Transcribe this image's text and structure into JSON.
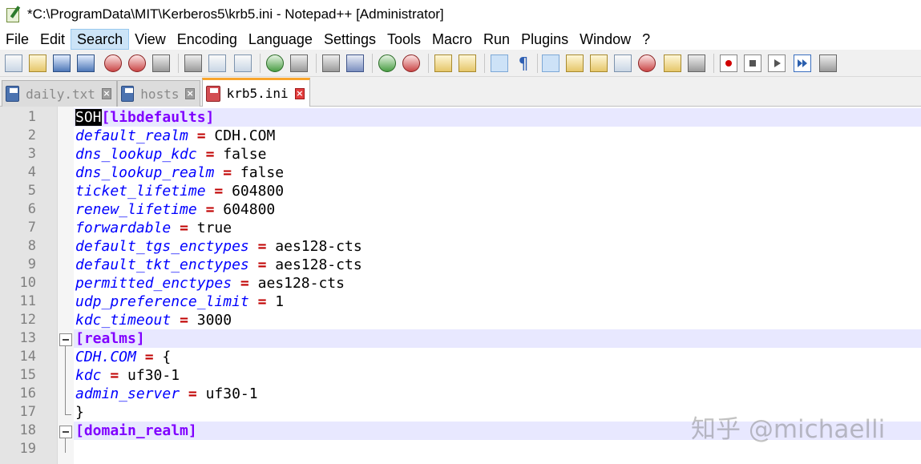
{
  "window": {
    "title": "*C:\\ProgramData\\MIT\\Kerberos5\\krb5.ini - Notepad++ [Administrator]"
  },
  "menu": [
    "File",
    "Edit",
    "Search",
    "View",
    "Encoding",
    "Language",
    "Settings",
    "Tools",
    "Macro",
    "Run",
    "Plugins",
    "Window",
    "?"
  ],
  "menu_active": "Search",
  "tabs": [
    {
      "label": "daily.txt",
      "icon": "save-icon",
      "active": false
    },
    {
      "label": "hosts",
      "icon": "save-icon",
      "active": false
    },
    {
      "label": "krb5.ini",
      "icon": "unsaved-icon",
      "active": true
    }
  ],
  "editor": {
    "current_line": 1,
    "lines": [
      {
        "n": "1",
        "soh": "SOH",
        "section": "[libdefaults]"
      },
      {
        "n": "2",
        "key": "default_realm",
        "op": "=",
        "val": "CDH.COM"
      },
      {
        "n": "3",
        "key": "dns_lookup_kdc",
        "op": "=",
        "val": "false"
      },
      {
        "n": "4",
        "key": "dns_lookup_realm",
        "op": "=",
        "val": "false"
      },
      {
        "n": "5",
        "key": "ticket_lifetime",
        "op": "=",
        "val": "604800"
      },
      {
        "n": "6",
        "key": "renew_lifetime",
        "op": "=",
        "val": "604800"
      },
      {
        "n": "7",
        "key": "forwardable",
        "op": "=",
        "val": "true"
      },
      {
        "n": "8",
        "key": "default_tgs_enctypes",
        "op": "=",
        "val": "aes128-cts"
      },
      {
        "n": "9",
        "key": "default_tkt_enctypes",
        "op": "=",
        "val": "aes128-cts"
      },
      {
        "n": "10",
        "key": "permitted_enctypes",
        "op": "=",
        "val": "aes128-cts"
      },
      {
        "n": "11",
        "key": "udp_preference_limit",
        "op": "=",
        "val": "1"
      },
      {
        "n": "12",
        "key": "kdc_timeout",
        "op": "=",
        "val": "3000"
      },
      {
        "n": "13",
        "section": "[realms]"
      },
      {
        "n": "14",
        "key": "CDH.COM",
        "op": "=",
        "val": "{"
      },
      {
        "n": "15",
        "key": "kdc",
        "op": "=",
        "val": "uf30-1"
      },
      {
        "n": "16",
        "key": "admin_server",
        "op": "=",
        "val": "uf30-1"
      },
      {
        "n": "17",
        "plain": "}"
      },
      {
        "n": "18",
        "section": "[domain_realm]"
      },
      {
        "n": "19"
      }
    ]
  },
  "watermark": "知乎 @michaelli"
}
